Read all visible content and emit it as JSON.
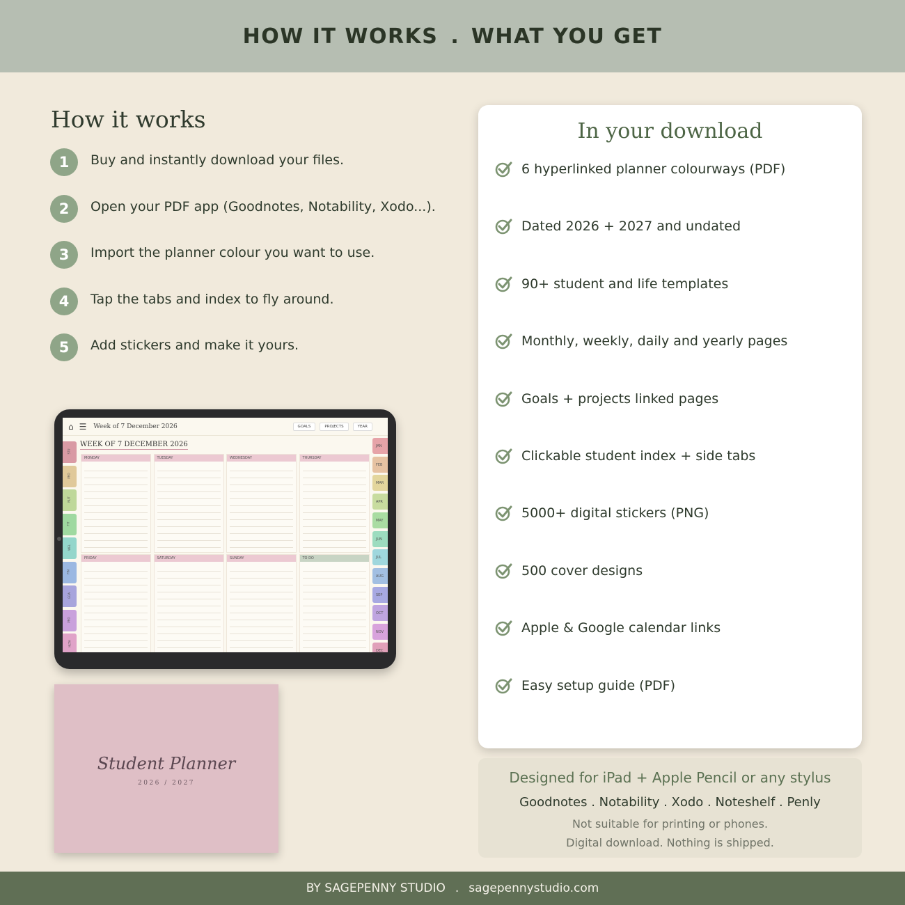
{
  "header": {
    "left": "HOW IT WORKS",
    "separator": ".",
    "right": "WHAT YOU GET"
  },
  "how_it_works": {
    "title": "How it works",
    "steps": [
      {
        "num": "1",
        "text": "Buy and instantly download your files."
      },
      {
        "num": "2",
        "text": "Open your PDF app (Goodnotes, Notability, Xodo...)."
      },
      {
        "num": "3",
        "text": "Import the planner colour you want to use."
      },
      {
        "num": "4",
        "text": "Tap the tabs and index to fly around."
      },
      {
        "num": "5",
        "text": "Add stickers and make it yours."
      }
    ]
  },
  "tablet": {
    "week_label": "Week of 7 December 2026",
    "nav": [
      "GOALS",
      "PROJECTS",
      "YEAR"
    ],
    "title": "WEEK OF 7 DECEMBER 2026",
    "days_top": [
      "MONDAY",
      "TUESDAY",
      "WEDNESDAY",
      "THURSDAY"
    ],
    "days_bottom": [
      "FRIDAY",
      "SATURDAY",
      "SUNDAY",
      "TO DO"
    ],
    "side_tabs": [
      {
        "label": "STU",
        "color": "#d99aa4"
      },
      {
        "label": "PRO",
        "color": "#e0c99a"
      },
      {
        "label": "NUT",
        "color": "#bfd89a"
      },
      {
        "label": "FIT",
        "color": "#9fd9a0"
      },
      {
        "label": "WEL",
        "color": "#94d6cb"
      },
      {
        "label": "FIN",
        "color": "#9bb8e2"
      },
      {
        "label": "GOA",
        "color": "#a7a4dc"
      },
      {
        "label": "PRO",
        "color": "#c9a1dc"
      },
      {
        "label": "HLTH",
        "color": "#e0a3c8"
      }
    ],
    "months": [
      {
        "label": "JAN",
        "color": "#e6a3a8"
      },
      {
        "label": "FEB",
        "color": "#e6c2a2"
      },
      {
        "label": "MAR",
        "color": "#e3d69d"
      },
      {
        "label": "APR",
        "color": "#c8dc9f"
      },
      {
        "label": "MAY",
        "color": "#a9dca2"
      },
      {
        "label": "JUN",
        "color": "#9ddcbf"
      },
      {
        "label": "JUL",
        "color": "#9fd7dd"
      },
      {
        "label": "AUG",
        "color": "#a2bfe2"
      },
      {
        "label": "SEP",
        "color": "#a7a9e2"
      },
      {
        "label": "OCT",
        "color": "#bfa5e0"
      },
      {
        "label": "NOV",
        "color": "#d8a3dc"
      },
      {
        "label": "DEC",
        "color": "#e0a0b9"
      }
    ],
    "day_head_color": "#ecc9d2",
    "todo_head_color": "#c8d4c4"
  },
  "cover": {
    "title": "Student Planner",
    "years": "2026 / 2027"
  },
  "download": {
    "title": "In your download",
    "items": [
      "6 hyperlinked planner colourways (PDF)",
      "Dated 2026 + 2027 and undated",
      "90+ student and life templates",
      "Monthly, weekly, daily and yearly pages",
      "Goals + projects linked pages",
      "Clickable student index + side tabs",
      "5000+ digital stickers (PNG)",
      "500 cover designs",
      "Apple & Google calendar links",
      "Easy setup guide (PDF)"
    ]
  },
  "compat": {
    "line1": "Designed for iPad + Apple Pencil or any stylus",
    "line2": "Goodnotes . Notability . Xodo . Noteshelf . Penly",
    "line3": "Not suitable for printing or phones.",
    "line4": "Digital download. Nothing is shipped."
  },
  "footer": {
    "brand": "BY SAGEPENNY STUDIO",
    "separator": ".",
    "url": "sagepennystudio.com"
  },
  "colors": {
    "accent": "#8fa588",
    "check": "#7c9371",
    "footer_bg": "#606f55",
    "header_bg": "#b6beb2"
  }
}
